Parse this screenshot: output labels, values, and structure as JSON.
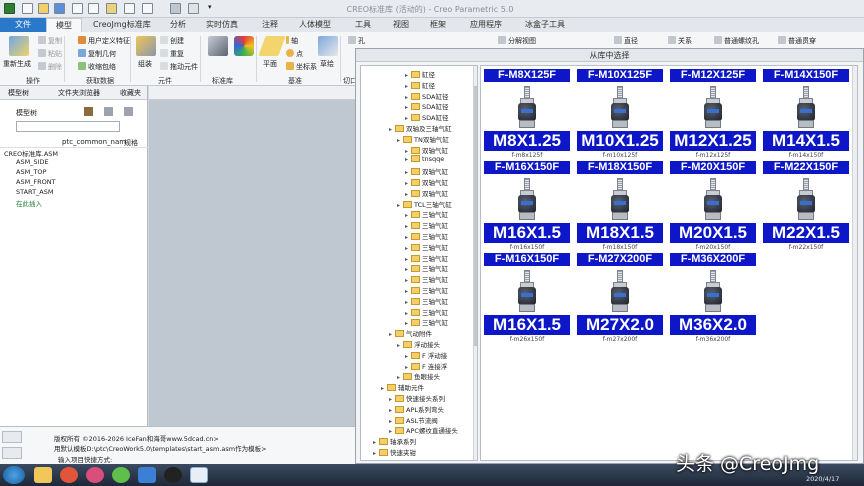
{
  "window": {
    "title": "CREO标准库 (活动的) - Creo Parametric 5.0"
  },
  "ribbon": {
    "tabs": [
      "文件",
      "模型",
      "CreoJmg标准库",
      "分析",
      "实时仿真",
      "注释",
      "人体模型",
      "工具",
      "视图",
      "框架",
      "应用程序",
      "冰盒子工具"
    ],
    "buttons": {
      "regenerate": "重新生成",
      "copy": "复制",
      "paste": "粘贴",
      "delete": "删除",
      "user_feature": "用户定义特征",
      "copy_geometry": "复制几何",
      "shrinkwrap": "收缩包络",
      "component": "组装",
      "create": "创建",
      "repeat": "重复",
      "pull_component": "拖动元件",
      "plane": "平面",
      "axis": "轴",
      "point": "点",
      "csys": "坐标系",
      "sketch": "草绘",
      "hole": "孔",
      "exploded_view": "分解视图",
      "straight": "直径",
      "relation": "关系",
      "thread": "普通螺纹孔",
      "thread2": "普通贯穿"
    },
    "groups": [
      "操作",
      "获取数据",
      "元件",
      "标准库",
      "基准",
      "切口"
    ]
  },
  "left_panel": {
    "tabs": [
      "模型树",
      "文件夹浏览器",
      "收藏夹"
    ],
    "section_label": "模型树",
    "columns": [
      "ptc_common_nam",
      "规格"
    ],
    "tree_items": [
      "CREO标准库.ASM",
      "ASM_SIDE",
      "ASM_TOP",
      "ASM_FRONT",
      "START_ASM",
      "在此插入"
    ]
  },
  "dialog": {
    "title": "从库中选择",
    "folder_tree": [
      {
        "label": "缸径",
        "indent": 5
      },
      {
        "label": "缸径",
        "indent": 5
      },
      {
        "label": "SDA缸径",
        "indent": 5
      },
      {
        "label": "SDA缸径",
        "indent": 5
      },
      {
        "label": "SDA缸径",
        "indent": 5
      },
      {
        "label": "双轴及三轴气缸",
        "indent": 3
      },
      {
        "label": "TN双轴气缸",
        "indent": 4
      },
      {
        "label": "双轴气缸",
        "indent": 5
      },
      {
        "label": "tnsqqe",
        "indent": 5
      },
      {
        "label": "双轴气缸",
        "indent": 5
      },
      {
        "label": "双轴气缸",
        "indent": 5
      },
      {
        "label": "双轴气缸",
        "indent": 5
      },
      {
        "label": "TCL三轴气缸",
        "indent": 4
      },
      {
        "label": "三轴气缸",
        "indent": 5
      },
      {
        "label": "三轴气缸",
        "indent": 5
      },
      {
        "label": "三轴气缸",
        "indent": 5
      },
      {
        "label": "三轴气缸",
        "indent": 5
      },
      {
        "label": "三轴气缸",
        "indent": 5
      },
      {
        "label": "三轴气缸",
        "indent": 5
      },
      {
        "label": "三轴气缸",
        "indent": 5
      },
      {
        "label": "三轴气缸",
        "indent": 5
      },
      {
        "label": "三轴气缸",
        "indent": 5
      },
      {
        "label": "三轴气缸",
        "indent": 5
      },
      {
        "label": "三轴气缸",
        "indent": 5
      },
      {
        "label": "气动附件",
        "indent": 3
      },
      {
        "label": "浮动接头",
        "indent": 4
      },
      {
        "label": "F 浮动接",
        "indent": 5
      },
      {
        "label": "F 连接浮",
        "indent": 5
      },
      {
        "label": "鱼眼接头",
        "indent": 4
      },
      {
        "label": "辅助元件",
        "indent": 2
      },
      {
        "label": "快速接头系列",
        "indent": 3
      },
      {
        "label": "APL系列弯头",
        "indent": 3
      },
      {
        "label": "ASL节流阀",
        "indent": 3
      },
      {
        "label": "APC螺纹直通接头",
        "indent": 3
      },
      {
        "label": "轴承系列",
        "indent": 1
      },
      {
        "label": "快速夹钳",
        "indent": 1
      }
    ],
    "parts": [
      {
        "top": "F-M8X125F",
        "big": "M8X1.25",
        "file": "f-m8x125f"
      },
      {
        "top": "F-M10X125F",
        "big": "M10X1.25",
        "file": "f-m10x125f"
      },
      {
        "top": "F-M12X125F",
        "big": "M12X1.25",
        "file": "f-m12x125f"
      },
      {
        "top": "F-M14X150F",
        "big": "M14X1.5",
        "file": "f-m14x150f"
      },
      {
        "top": "F-M16X150F",
        "big": "M16X1.5",
        "file": "f-m16x150f"
      },
      {
        "top": "F-M18X150F",
        "big": "M18X1.5",
        "file": "f-m18x150f"
      },
      {
        "top": "F-M20X150F",
        "big": "M20X1.5",
        "file": "f-m20x150f"
      },
      {
        "top": "F-M22X150F",
        "big": "M22X1.5",
        "file": "f-m22x150f"
      },
      {
        "top": "F-M16X150F",
        "big": "M16X1.5",
        "file": "f-m26x150f"
      },
      {
        "top": "F-M27X200F",
        "big": "M27X2.0",
        "file": "f-m27x200f"
      },
      {
        "top": "F-M36X200F",
        "big": "M36X2.0",
        "file": "f-m36x200f"
      }
    ]
  },
  "messages": [
    "版权所有 ©2016-2026 IceFan和海哥www.5dcad.cn>",
    "用默认模板D:\\ptc\\CreoWork5.0\\templates\\start_asm.asm作为模板>",
    "输入项目快捷方式:"
  ],
  "watermark": "头条 @CreoJmg",
  "clock": "2020/4/17",
  "colors": {
    "label_blue": "#0e17c8",
    "file_tab": "#2a78c9"
  }
}
